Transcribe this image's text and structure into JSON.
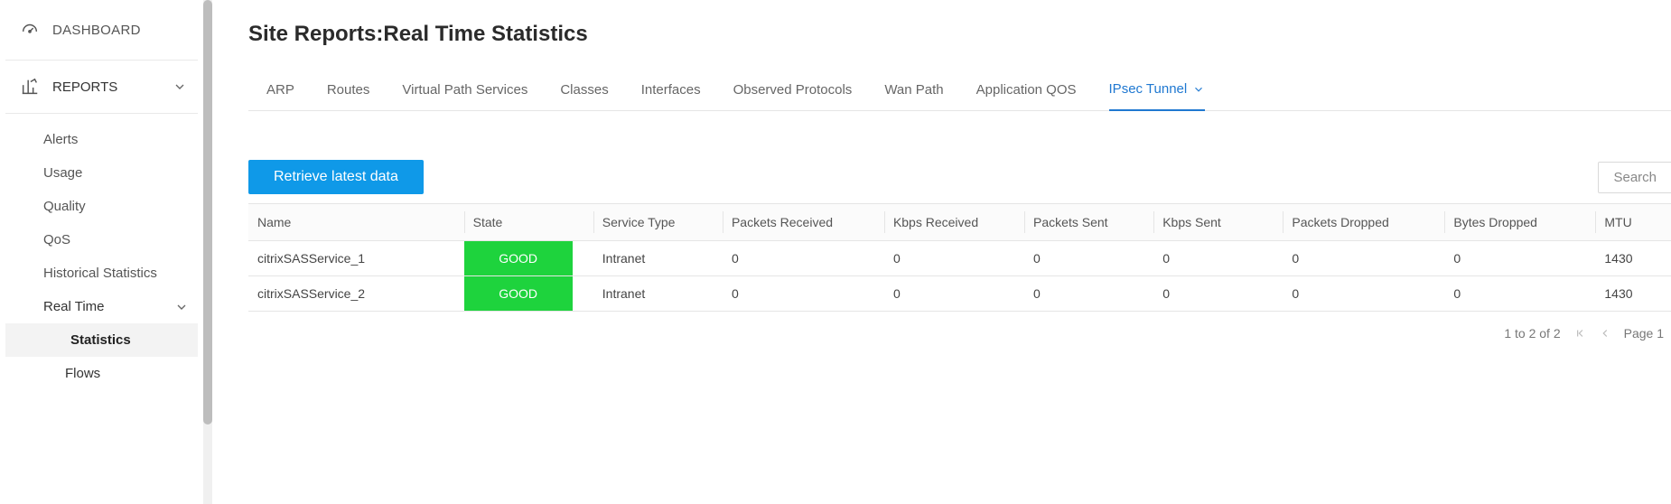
{
  "sidebar": {
    "dashboard": "DASHBOARD",
    "reports": "REPORTS",
    "items": [
      "Alerts",
      "Usage",
      "Quality",
      "QoS",
      "Historical Statistics"
    ],
    "realtime": {
      "label": "Real Time",
      "children": [
        "Statistics",
        "Flows"
      ],
      "activeIndex": 0
    }
  },
  "page": {
    "title": "Site Reports:Real Time Statistics"
  },
  "tabs": {
    "items": [
      "ARP",
      "Routes",
      "Virtual Path Services",
      "Classes",
      "Interfaces",
      "Observed Protocols",
      "Wan Path",
      "Application QOS",
      "IPsec Tunnel"
    ],
    "activeIndex": 8
  },
  "toolbar": {
    "retrieve": "Retrieve latest data",
    "search": "Search"
  },
  "table": {
    "columns": [
      "Name",
      "State",
      "Service Type",
      "Packets Received",
      "Kbps Received",
      "Packets Sent",
      "Kbps Sent",
      "Packets Dropped",
      "Bytes Dropped",
      "MTU"
    ],
    "rows": [
      {
        "name": "citrixSASService_1",
        "state": "GOOD",
        "service_type": "Intranet",
        "packets_received": "0",
        "kbps_received": "0",
        "packets_sent": "0",
        "kbps_sent": "0",
        "packets_dropped": "0",
        "bytes_dropped": "0",
        "mtu": "1430"
      },
      {
        "name": "citrixSASService_2",
        "state": "GOOD",
        "service_type": "Intranet",
        "packets_received": "0",
        "kbps_received": "0",
        "packets_sent": "0",
        "kbps_sent": "0",
        "packets_dropped": "0",
        "bytes_dropped": "0",
        "mtu": "1430"
      }
    ]
  },
  "pager": {
    "range": "1 to 2 of 2",
    "page_label": "Page 1"
  }
}
